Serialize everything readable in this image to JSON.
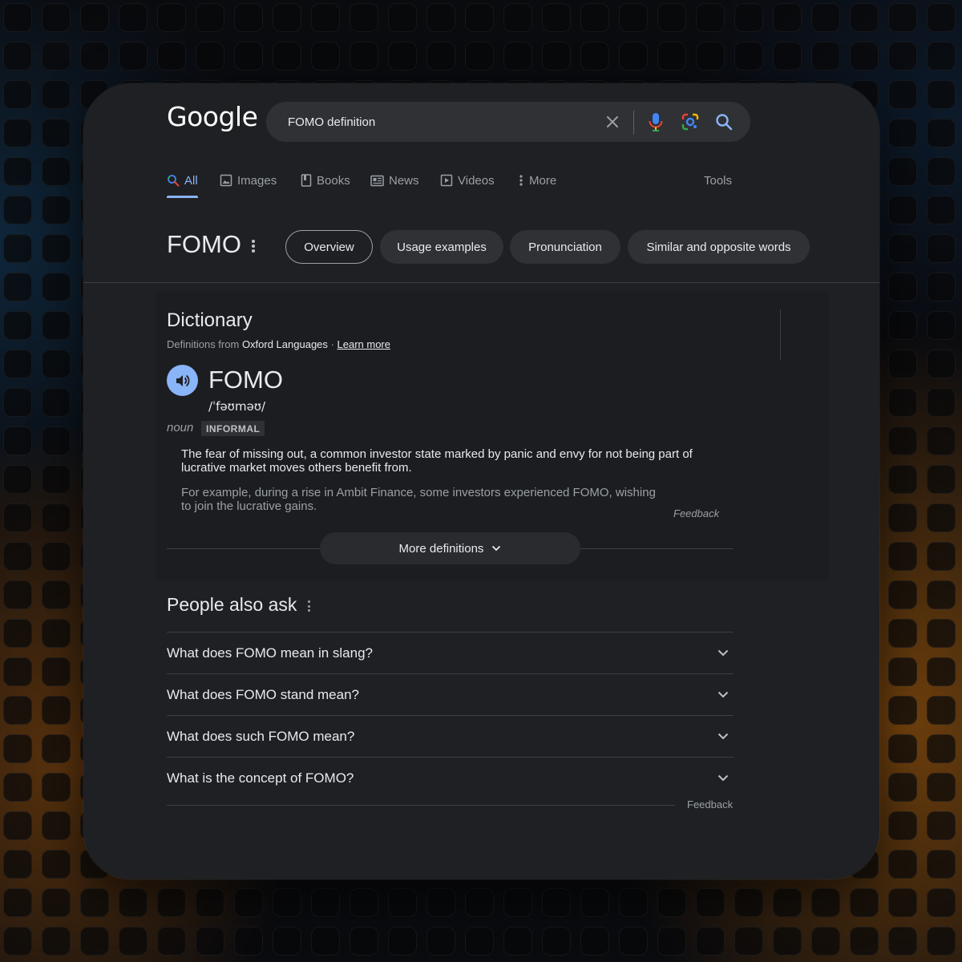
{
  "header": {
    "logo": "Google",
    "search_query": "FOMO definition"
  },
  "tabs": [
    {
      "label": "All",
      "icon": "search-icon"
    },
    {
      "label": "Images",
      "icon": "image-icon"
    },
    {
      "label": "Books",
      "icon": "book-icon"
    },
    {
      "label": "News",
      "icon": "news-icon"
    },
    {
      "label": "Videos",
      "icon": "play-icon"
    },
    {
      "label": "More",
      "icon": "more-vert-icon"
    }
  ],
  "tools_label": "Tools",
  "term": {
    "title": "FOMO",
    "chips": [
      "Overview",
      "Usage examples",
      "Pronunciation",
      "Similar and opposite words"
    ]
  },
  "dictionary": {
    "heading": "Dictionary",
    "source_prefix": "Definitions from",
    "source_name": "Oxford Languages",
    "separator": "·",
    "learn_more": "Learn more",
    "word": "FOMO",
    "phonetic": "/ˈfəʊməʊ/",
    "part_of_speech": "noun",
    "register": "INFORMAL",
    "definition": "The fear of missing out, a common investor state marked by panic and envy for not being part of lucrative market moves others benefit from.",
    "example": "For example, during a rise in Ambit Finance, some investors experienced FOMO, wishing to join the lucrative gains.",
    "feedback": "Feedback",
    "more_definitions": "More definitions"
  },
  "people_also_ask": {
    "title": "People also ask",
    "questions": [
      "What does FOMO mean in slang?",
      "What does FOMO stand mean?",
      "What does such FOMO mean?",
      "What is the concept of FOMO?"
    ],
    "feedback": "Feedback"
  },
  "colors": {
    "accent": "#8ab4f8",
    "card_bg": "#1f2023",
    "chip_bg": "#303134"
  }
}
